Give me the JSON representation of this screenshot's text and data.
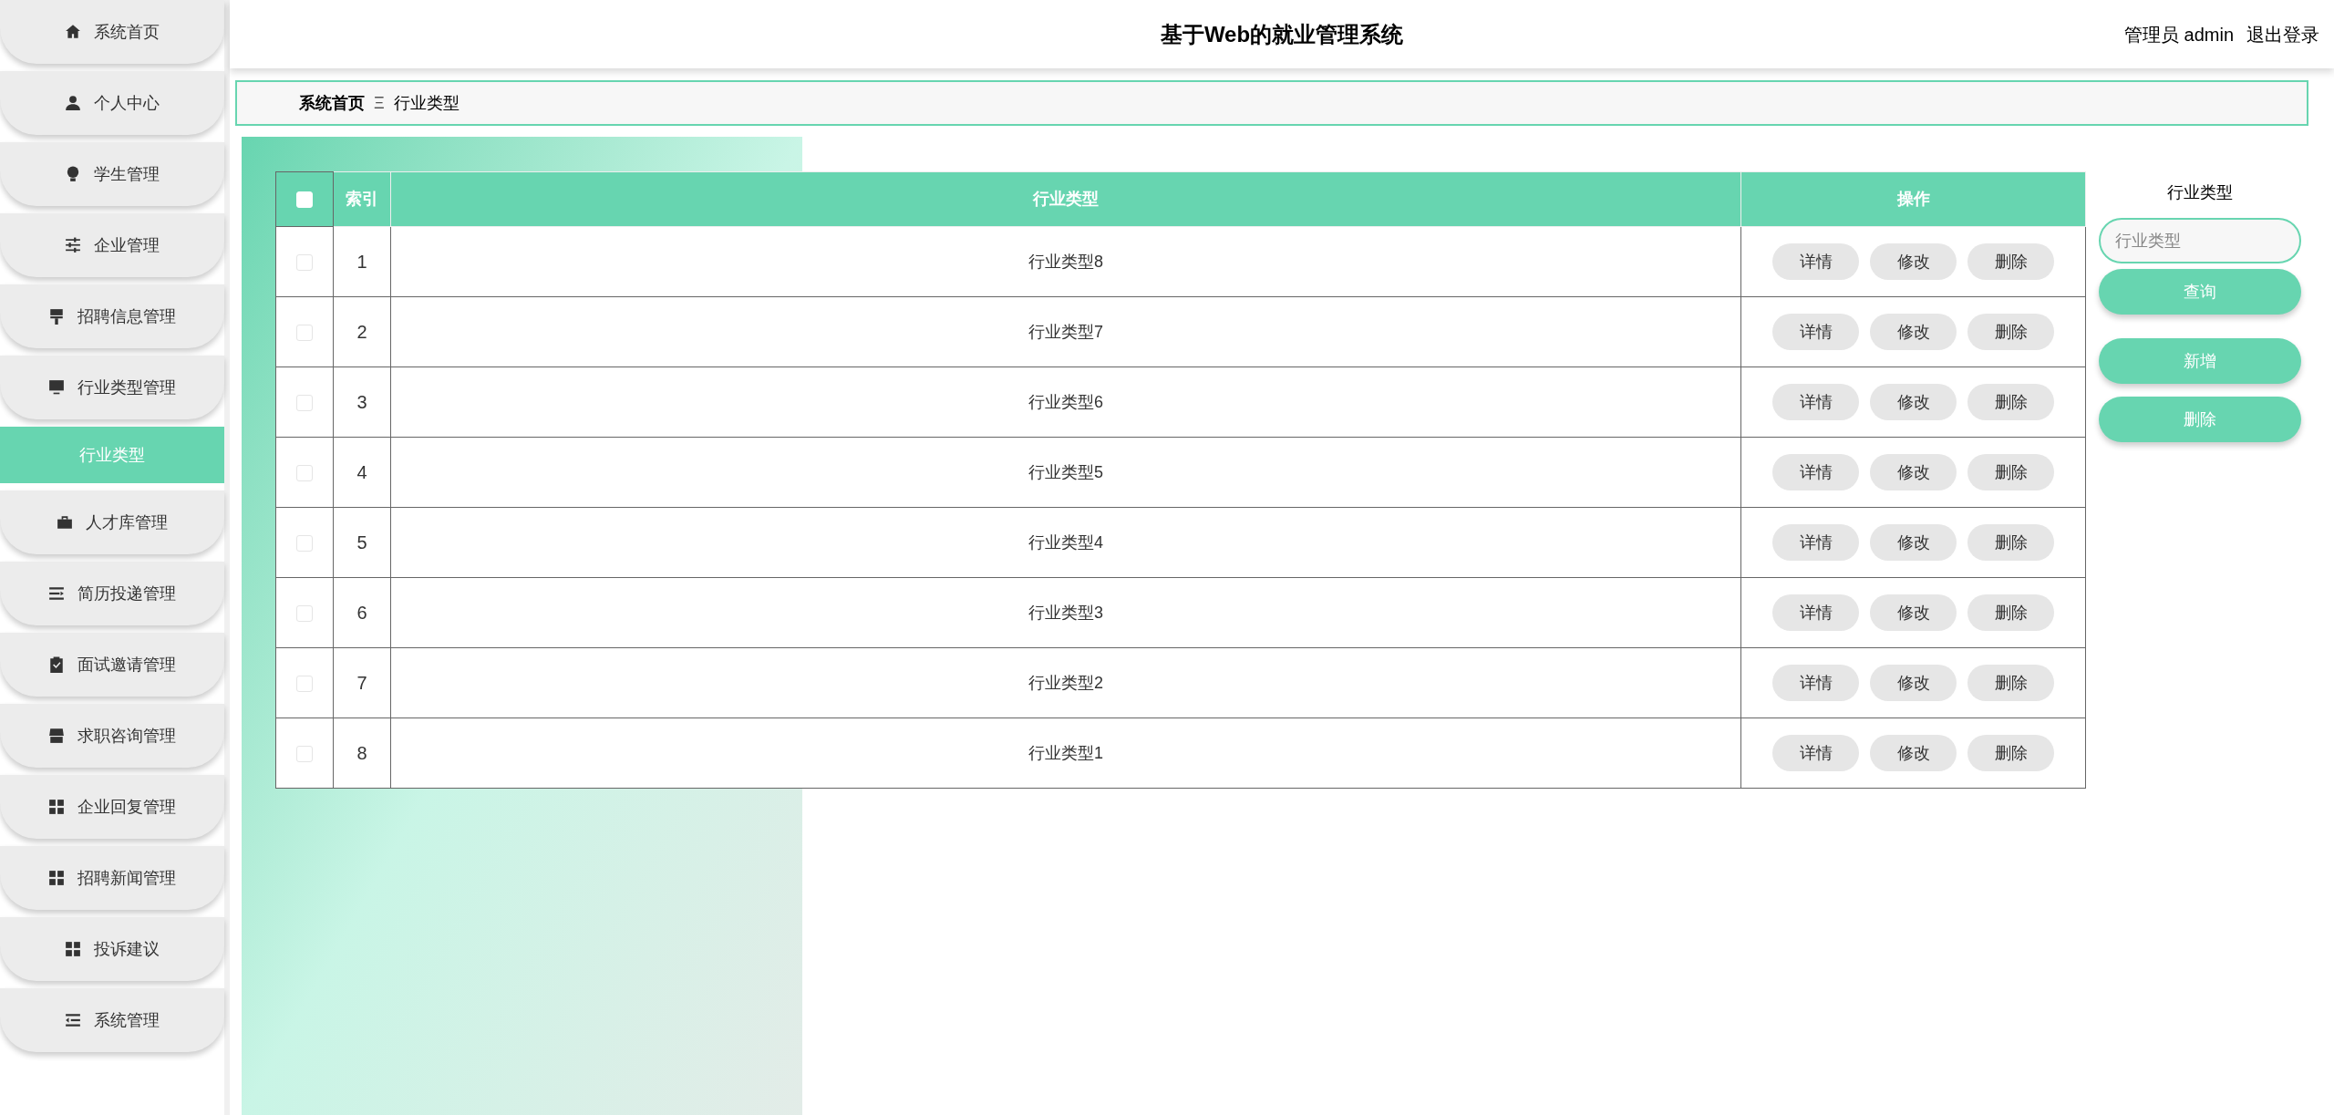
{
  "header": {
    "title": "基于Web的就业管理系统",
    "user": "管理员 admin",
    "logout": "退出登录"
  },
  "sidebar": {
    "items": [
      {
        "label": "系统首页",
        "selected": false
      },
      {
        "label": "个人中心",
        "selected": false
      },
      {
        "label": "学生管理",
        "selected": false
      },
      {
        "label": "企业管理",
        "selected": false
      },
      {
        "label": "招聘信息管理",
        "selected": false
      },
      {
        "label": "行业类型管理",
        "selected": false,
        "children": [
          {
            "label": "行业类型",
            "selected": true
          }
        ]
      },
      {
        "label": "人才库管理",
        "selected": false
      },
      {
        "label": "简历投递管理",
        "selected": false
      },
      {
        "label": "面试邀请管理",
        "selected": false
      },
      {
        "label": "求职咨询管理",
        "selected": false
      },
      {
        "label": "企业回复管理",
        "selected": false
      },
      {
        "label": "招聘新闻管理",
        "selected": false
      },
      {
        "label": "投诉建议",
        "selected": false
      },
      {
        "label": "系统管理",
        "selected": false
      }
    ]
  },
  "breadcrumb": {
    "home": "系统首页",
    "separator": "Ξ",
    "current": "行业类型"
  },
  "table": {
    "select_all": {
      "checked": false
    },
    "columns": [
      "索引",
      "行业类型",
      "操作"
    ],
    "rows": [
      {
        "checked": false,
        "index": "1",
        "type": "行业类型8",
        "actions": [
          "详情",
          "修改",
          "删除"
        ]
      },
      {
        "checked": false,
        "index": "2",
        "type": "行业类型7",
        "actions": [
          "详情",
          "修改",
          "删除"
        ]
      },
      {
        "checked": false,
        "index": "3",
        "type": "行业类型6",
        "actions": [
          "详情",
          "修改",
          "删除"
        ]
      },
      {
        "checked": false,
        "index": "4",
        "type": "行业类型5",
        "actions": [
          "详情",
          "修改",
          "删除"
        ]
      },
      {
        "checked": false,
        "index": "5",
        "type": "行业类型4",
        "actions": [
          "详情",
          "修改",
          "删除"
        ]
      },
      {
        "checked": false,
        "index": "6",
        "type": "行业类型3",
        "actions": [
          "详情",
          "修改",
          "删除"
        ]
      },
      {
        "checked": false,
        "index": "7",
        "type": "行业类型2",
        "actions": [
          "详情",
          "修改",
          "删除"
        ]
      },
      {
        "checked": false,
        "index": "8",
        "type": "行业类型1",
        "actions": [
          "详情",
          "修改",
          "删除"
        ]
      }
    ]
  },
  "search": {
    "label": "行业类型",
    "placeholder": "行业类型",
    "button": "查询"
  },
  "actions": [
    "新增",
    "删除"
  ]
}
